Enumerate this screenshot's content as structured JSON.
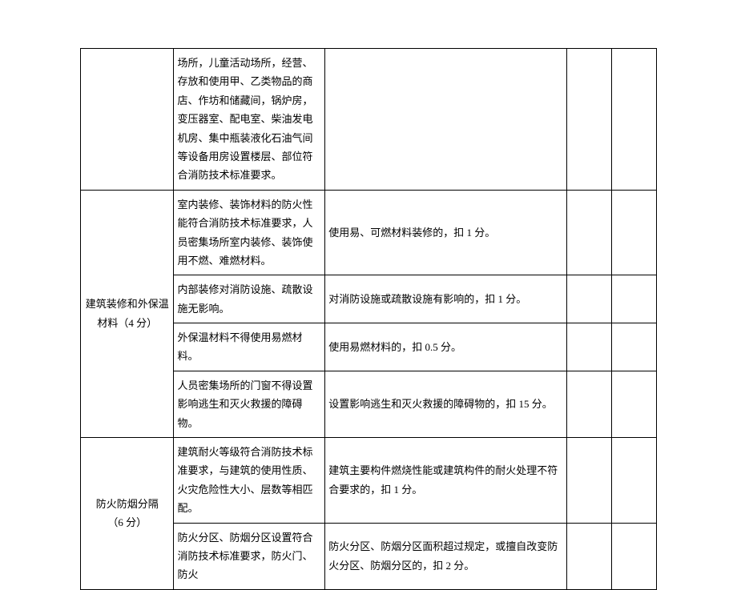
{
  "rows": [
    {
      "cat": "",
      "criteria": "场所，儿童活动场所，经营、存放和使用甲、乙类物品的商店、作坊和储藏间，锅炉房，变压器室、配电室、柴油发电机房、集中瓶装液化石油气间等设备用房设置楼层、部位符合消防技术标准要求。",
      "scoring": ""
    },
    {
      "cat": "建筑装修和外保温材料（4 分）",
      "rows": [
        {
          "criteria": "室内装修、装饰材料的防火性能符合消防技术标准要求，人员密集场所室内装修、装饰使用不燃、难燃材料。",
          "scoring": "使用易、可燃材料装修的，扣 1 分。"
        },
        {
          "criteria": "内部装修对消防设施、疏散设施无影响。",
          "scoring": "对消防设施或疏散设施有影响的，扣 1 分。"
        },
        {
          "criteria": "外保温材料不得使用易燃材料。",
          "scoring": "使用易燃材料的，扣 0.5 分。"
        },
        {
          "criteria": "人员密集场所的门窗不得设置影响逃生和灭火救援的障碍物。",
          "scoring": "设置影响逃生和灭火救援的障碍物的，扣 15 分。"
        }
      ]
    },
    {
      "cat": "防火防烟分隔\n（6 分）",
      "rows": [
        {
          "criteria": "建筑耐火等级符合消防技术标准要求，与建筑的使用性质、火灾危险性大小、层数等相匹配。",
          "scoring": "建筑主要构件燃烧性能或建筑构件的耐火处理不符合要求的，扣 1 分。"
        },
        {
          "criteria": "防火分区、防烟分区设置符合消防技术标准要求，防火门、防火",
          "scoring": "防火分区、防烟分区面积超过规定，或擅自改变防火分区、防烟分区的，扣 2 分。"
        }
      ]
    }
  ]
}
